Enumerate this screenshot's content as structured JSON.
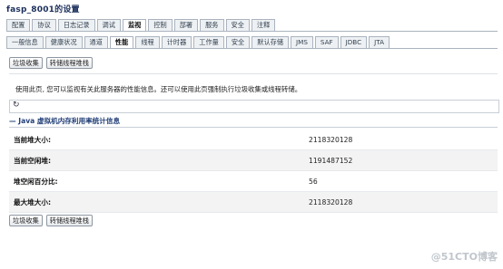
{
  "page": {
    "title": "fasp_8001的设置"
  },
  "primary_tabs": [
    "配置",
    "协议",
    "日志记录",
    "调试",
    "监视",
    "控制",
    "部署",
    "服务",
    "安全",
    "注释"
  ],
  "secondary_tabs": [
    "一般信息",
    "健康状况",
    "通道",
    "性能",
    "线程",
    "计时器",
    "工作量",
    "安全",
    "默认存储",
    "JMS",
    "SAF",
    "JDBC",
    "JTA"
  ],
  "active_primary_tab": "监视",
  "active_secondary_tab": "性能",
  "toolbar": {
    "gc_label": "垃圾收集",
    "dump_label": "转储线程堆栈"
  },
  "description": "使用此页, 您可以监视有关此服务器的性能信息。还可以使用此页强制执行垃圾收集或线程转储。",
  "refresh": {
    "icon": "refresh-icon"
  },
  "section": {
    "title": "Java 虚拟机内存利用率统计信息"
  },
  "stats": [
    {
      "label": "当前堆大小:",
      "value": "2118320128"
    },
    {
      "label": "当前空闲堆:",
      "value": "1191487152"
    },
    {
      "label": "堆空闲百分比:",
      "value": "56"
    },
    {
      "label": "最大堆大小:",
      "value": "2118320128"
    }
  ],
  "watermark": "@51CTO博客"
}
